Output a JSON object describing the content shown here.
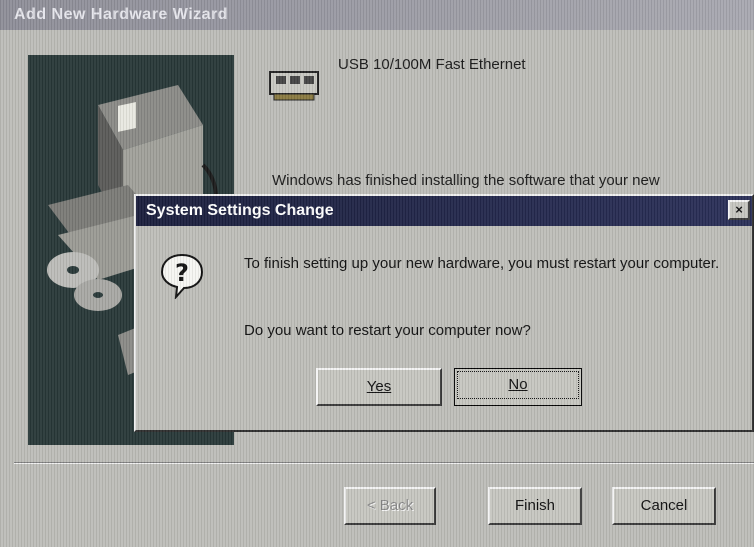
{
  "wizard": {
    "title": "Add New Hardware Wizard",
    "device_name": "USB 10/100M Fast Ethernet",
    "finished_text": "Windows has finished installing the software that your new",
    "buttons": {
      "back": "< Back",
      "finish": "Finish",
      "cancel": "Cancel"
    }
  },
  "dialog": {
    "title": "System Settings Change",
    "close_glyph": "×",
    "message": "To finish setting up your new hardware, you must restart your computer.",
    "question": "Do you want to restart your computer now?",
    "yes_label": "Yes",
    "no_label": "No",
    "icon": "question-icon"
  }
}
